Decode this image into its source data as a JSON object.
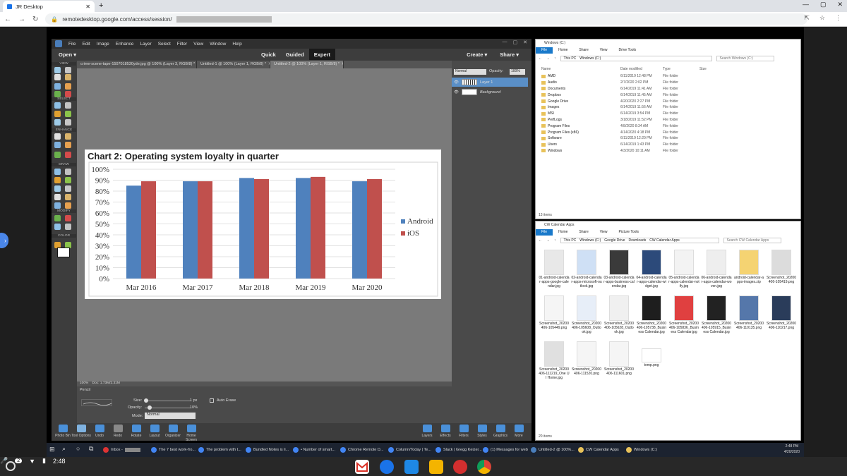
{
  "browser": {
    "tab_title": "JR Desktop",
    "url_prefix": "remotedesktop.google.com/access/session/"
  },
  "pse": {
    "menu": [
      "File",
      "Edit",
      "Image",
      "Enhance",
      "Layer",
      "Select",
      "Filter",
      "View",
      "Window",
      "Help"
    ],
    "open_label": "Open",
    "modes": [
      "Quick",
      "Guided",
      "Expert"
    ],
    "create_label": "Create",
    "share_label": "Share",
    "doc_tabs": [
      "crime-scene-tape-1507018530yde.jpg @ 100% (Layer 3, RGB/8) *",
      "Untitled-1 @ 100% (Layer 1, RGB/8) *",
      "Untitled-2 @ 100% (Layer 1, RGB/8) *"
    ],
    "tool_sections": [
      "VIEW",
      "SELECT",
      "ENHANCE",
      "DRAW",
      "MODIFY",
      "COLOR"
    ],
    "status": "100%",
    "doc_info": "Doc: 1.73M/2.31M",
    "tool_name": "Pencil",
    "size_label": "Size:",
    "size_value": "1 px",
    "opacity_label": "Opacity:",
    "opacity_value": "10%",
    "mode_label": "Mode:",
    "mode_value": "Normal",
    "auto_erase": "Auto Erase",
    "blend_mode": "Normal",
    "layer_opacity_label": "Opacity:",
    "layer_opacity_value": "100%",
    "layers": [
      "Layer 1",
      "Background"
    ],
    "bottom_left": [
      "Photo Bin",
      "Tool Options",
      "Undo",
      "Redo",
      "Rotate",
      "Layout",
      "Organizer",
      "Home Screen"
    ],
    "bottom_right": [
      "Layers",
      "Effects",
      "Filters",
      "Styles",
      "Graphics",
      "More"
    ]
  },
  "chart_data": {
    "type": "bar",
    "title": "Chart 2: Operating system loyalty in quarter",
    "categories": [
      "Mar 2016",
      "Mar 2017",
      "Mar 2018",
      "Mar 2019",
      "Mar 2020"
    ],
    "series": [
      {
        "name": "Android",
        "values": [
          85,
          89,
          92,
          92,
          89
        ],
        "color": "#4f81bd"
      },
      {
        "name": "iOS",
        "values": [
          89,
          89,
          91,
          93,
          91
        ],
        "color": "#c0504d"
      }
    ],
    "yticks": [
      "0%",
      "10%",
      "20%",
      "30%",
      "40%",
      "50%",
      "60%",
      "70%",
      "80%",
      "90%",
      "100%"
    ],
    "ylim": [
      0,
      100
    ],
    "legend": "right",
    "grid": true
  },
  "explorer1": {
    "title": "Windows (C:)",
    "ribbon": [
      "File",
      "Home",
      "Share",
      "View",
      "Drive Tools"
    ],
    "path": [
      "This PC",
      "Windows (C:)"
    ],
    "search": "Search Windows (C:)",
    "columns": [
      "Name",
      "Date modified",
      "Type",
      "Size"
    ],
    "rows": [
      [
        "AMD",
        "6/11/2019 12:48 PM",
        "File folder"
      ],
      [
        "Audio",
        "2/7/2020 2:02 PM",
        "File folder"
      ],
      [
        "Documents",
        "6/14/2019 11:41 AM",
        "File folder"
      ],
      [
        "Dropbox",
        "6/14/2019 11:45 AM",
        "File folder"
      ],
      [
        "Google Drive",
        "4/20/2020 2:27 PM",
        "File folder"
      ],
      [
        "Images",
        "6/14/2019 11:56 AM",
        "File folder"
      ],
      [
        "MSI",
        "6/14/2019 3:54 PM",
        "File folder"
      ],
      [
        "PerfLogs",
        "3/18/2019 11:52 PM",
        "File folder"
      ],
      [
        "Program Files",
        "4/8/2020 8:34 AM",
        "File folder"
      ],
      [
        "Program Files (x86)",
        "4/14/2020 4:18 PM",
        "File folder"
      ],
      [
        "Software",
        "6/11/2019 12:20 PM",
        "File folder"
      ],
      [
        "Users",
        "6/14/2019 1:43 PM",
        "File folder"
      ],
      [
        "Windows",
        "4/3/2020 10:11 AM",
        "File folder"
      ]
    ],
    "footer": "13 items"
  },
  "explorer2": {
    "title": "CW Calendar Apps",
    "ribbon": [
      "File",
      "Home",
      "Share",
      "View",
      "Picture Tools"
    ],
    "path": [
      "This PC",
      "Windows (C:)",
      "Google Drive",
      "Downloads",
      "CW Calendar Apps"
    ],
    "search": "Search CW Calendar Apps",
    "files": [
      "01-android-calendar-apps-google-calendar.jpg",
      "02-android-calendar-apps-microsoft-outlook.jpg",
      "03-android-calendar-apps-business-calendar.jpg",
      "04-android-calendar-apps-calendar-widget.jpg",
      "05-android-calendar-apps-calendar-notify.jpg",
      "06-android-calendar-apps-calendar-woven.jpg",
      "android-calendar-apps-images.zip",
      "Screenshot_20200406-105419.png",
      "Screenshot_20200406-105449.png",
      "Screenshot_20200406-105608_Outlook.jpg",
      "Screenshot_20200406-105628_Outlook.jpg",
      "Screenshot_20200406-105738_Business Calendar.jpg",
      "Screenshot_20200406-105836_Business Calendar.jpg",
      "Screenshot_20200406-105915_Business Calendar.jpg",
      "Screenshot_20200406-110135.png",
      "Screenshot_20200406-110217.png",
      "Screenshot_20200406-111219_One UI Home.jpg",
      "Screenshot_20200406-111520.png",
      "Screenshot_20200406-111601.png",
      "temp.png"
    ],
    "footer": "20 items"
  },
  "win_taskbar": {
    "items": [
      "Inbox -",
      "The 7 best work-fro...",
      "The problem with t...",
      "Bundled Notes is li...",
      "• Number of smart...",
      "Chrome Remote D...",
      "Column/Today | Te...",
      "Slack | Gregg Keizer...",
      "(1) Messages for web",
      "Untitled-2 @ 100%...",
      "CW Calendar Apps",
      "Windows (C:)"
    ],
    "time": "2:48 PM",
    "date": "4/20/2020"
  },
  "shelf": {
    "time": "2:48",
    "badge": "2"
  }
}
